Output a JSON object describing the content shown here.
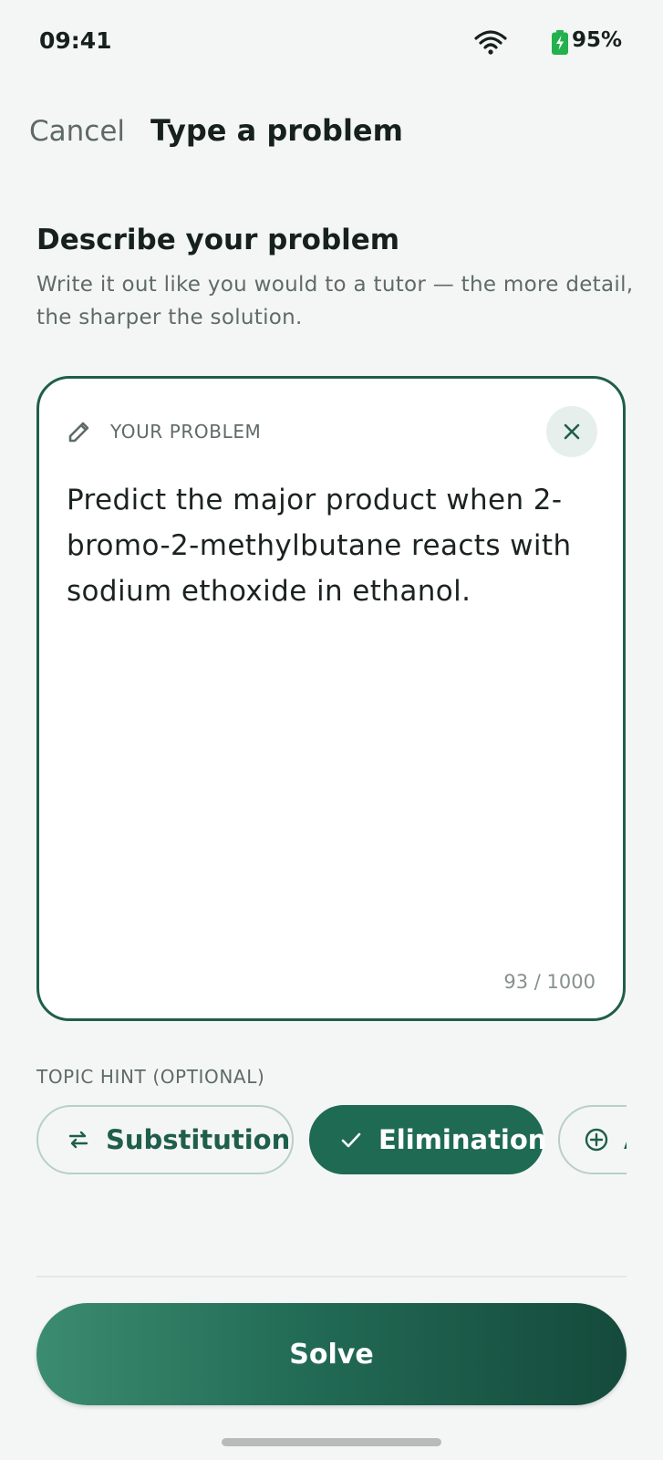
{
  "status_bar": {
    "time": "09:41",
    "battery_percent": "95%",
    "icons": [
      "wifi-icon",
      "battery-charging-icon"
    ]
  },
  "top_bar": {
    "cancel_label": "Cancel",
    "title": "Type a problem"
  },
  "section": {
    "title": "Describe your problem",
    "subtitle": "Write it out like you would to a tutor — the more detail, the sharper the solution."
  },
  "problem_card": {
    "label": "YOUR PROBLEM",
    "icon": "pencil-icon",
    "clear_icon": "close-icon",
    "text": "Predict the major product when 2-bromo-2-methylbutane reacts with sodium ethoxide in ethanol.",
    "char_count": "93 / 1000"
  },
  "topic_hint": {
    "label": "TOPIC HINT (OPTIONAL)",
    "chips": [
      {
        "label": "Substitution",
        "icon": "swap-arrows-icon",
        "selected": false
      },
      {
        "label": "Elimination",
        "icon": "check-icon",
        "selected": true
      },
      {
        "label": "A",
        "icon": "plus-circle-icon",
        "selected": false
      }
    ]
  },
  "solve_button": {
    "label": "Solve"
  },
  "colors": {
    "accent": "#1f6a53",
    "accent_dark": "#154a3b",
    "background": "#f4f6f5",
    "card_border": "#1f5e4a"
  }
}
